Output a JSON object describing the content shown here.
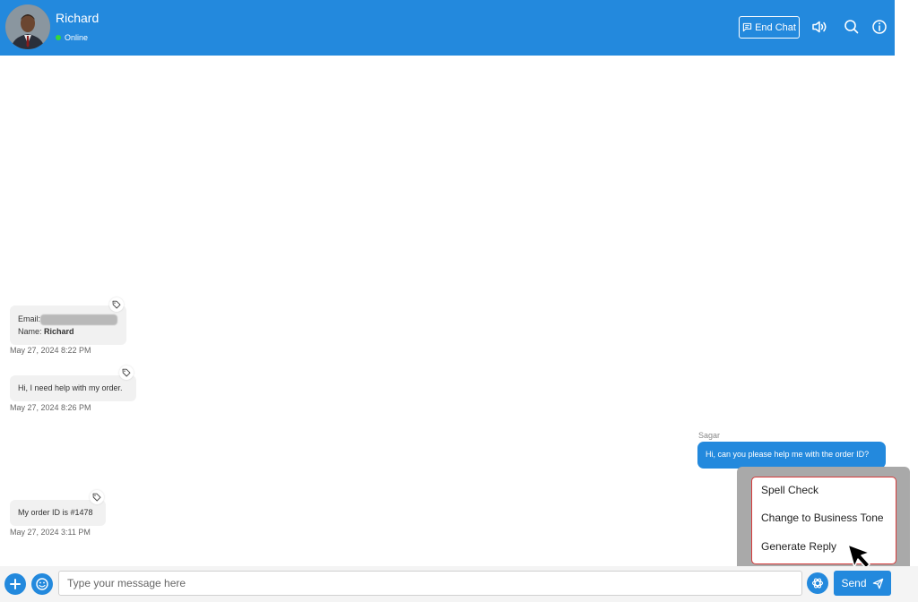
{
  "header": {
    "contact_name": "Richard",
    "status": "Online",
    "end_chat_label": "End Chat",
    "colors": {
      "bar": "#2389dd",
      "status_dot": "#35d83a"
    }
  },
  "messages": [
    {
      "direction": "incoming",
      "email_label": "Email:",
      "name_label": "Name:",
      "name_value": "Richard",
      "timestamp": "May 27, 2024 8:22 PM"
    },
    {
      "direction": "incoming",
      "text": "Hi, I need help with my order.",
      "timestamp": "May 27, 2024 8:26 PM"
    },
    {
      "direction": "outgoing",
      "sender": "Sagar",
      "text": "Hi, can you please help me with the order ID?"
    },
    {
      "direction": "incoming",
      "text": "My order ID is #1478",
      "timestamp": "May 27, 2024 3:11 PM"
    }
  ],
  "ai_menu": {
    "items": [
      "Spell Check",
      "Change to Business Tone",
      "Generate Reply"
    ]
  },
  "composer": {
    "placeholder": "Type your message here",
    "send_label": "Send"
  }
}
